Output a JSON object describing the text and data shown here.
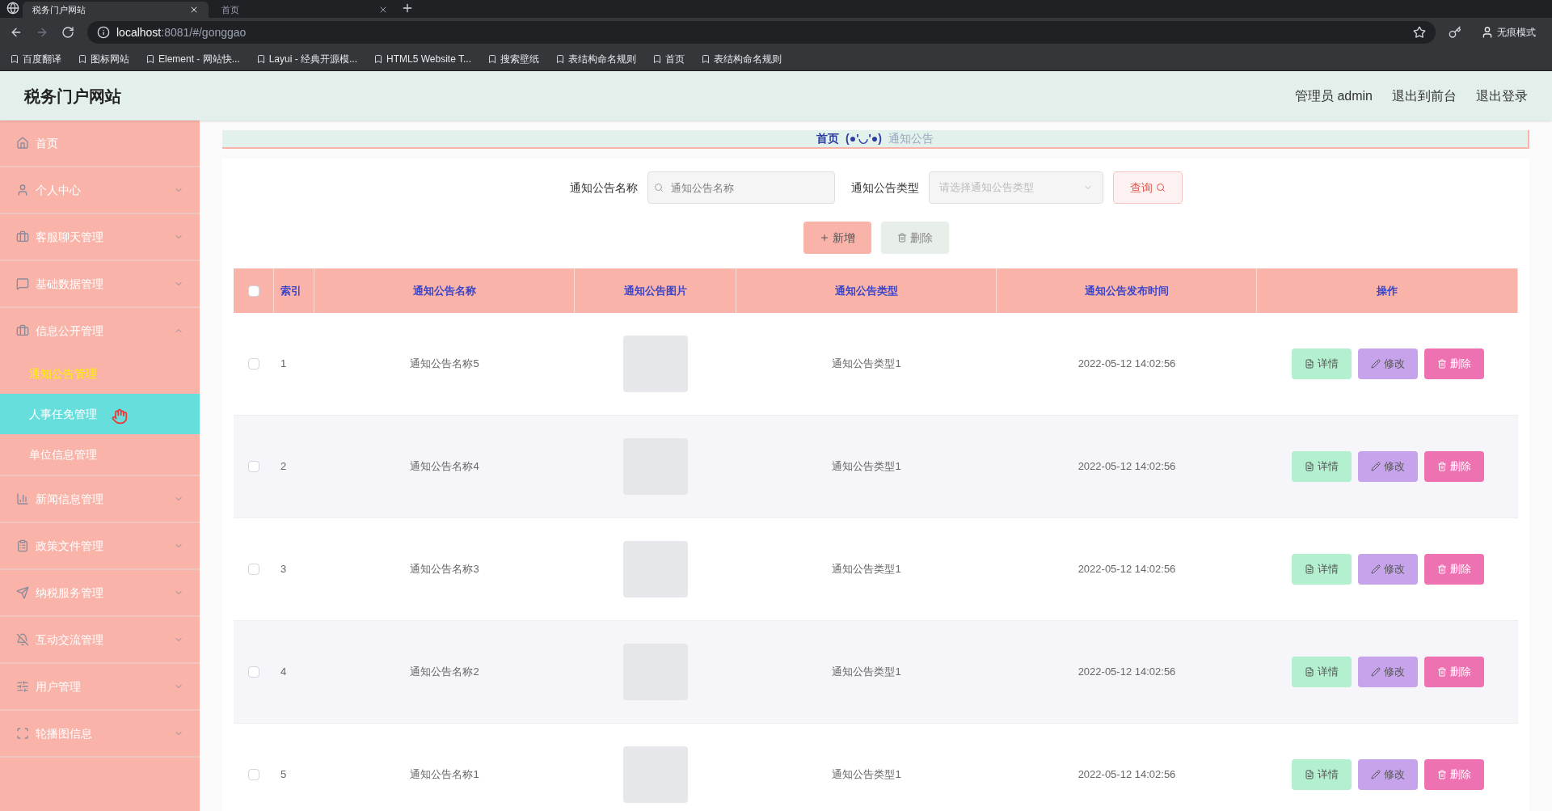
{
  "browser": {
    "tabs": [
      {
        "title": "税务门户网站",
        "selected": true
      },
      {
        "title": "首页",
        "selected": false
      }
    ],
    "url_host": "localhost",
    "url_rest": ":8081/#/gonggao",
    "profile": "无痕模式",
    "bookmarks": [
      "百度翻译",
      "图标网站",
      "Element - 网站快...",
      "Layui - 经典开源模...",
      "HTML5 Website T...",
      "搜索壁纸",
      "表结构命名规则",
      "首页",
      "表结构命名规则"
    ]
  },
  "header": {
    "title": "税务门户网站",
    "links": [
      "管理员 admin",
      "退出到前台",
      "退出登录"
    ]
  },
  "sidebar": {
    "items": [
      {
        "label": "首页",
        "kind": "link"
      },
      {
        "label": "个人中心",
        "kind": "group",
        "expanded": false
      },
      {
        "label": "客服聊天管理",
        "kind": "group",
        "expanded": false
      },
      {
        "label": "基础数据管理",
        "kind": "group",
        "expanded": false
      },
      {
        "label": "信息公开管理",
        "kind": "group",
        "expanded": true,
        "children": [
          {
            "label": "通知公告管理",
            "selected": true,
            "hovered": false
          },
          {
            "label": "人事任免管理",
            "selected": false,
            "hovered": true
          },
          {
            "label": "单位信息管理",
            "selected": false,
            "hovered": false
          }
        ]
      },
      {
        "label": "新闻信息管理",
        "kind": "group",
        "expanded": false
      },
      {
        "label": "政策文件管理",
        "kind": "group",
        "expanded": false
      },
      {
        "label": "纳税服务管理",
        "kind": "group",
        "expanded": false
      },
      {
        "label": "互动交流管理",
        "kind": "group",
        "expanded": false
      },
      {
        "label": "用户管理",
        "kind": "group",
        "expanded": false
      },
      {
        "label": "轮播图信息",
        "kind": "group",
        "expanded": false
      }
    ]
  },
  "breadcrumb": {
    "home": "首页",
    "separator": "(●'◡'●)",
    "current": "通知公告"
  },
  "search": {
    "name_label": "通知公告名称",
    "name_placeholder": "通知公告名称",
    "type_label": "通知公告类型",
    "type_placeholder": "请选择通知公告类型",
    "query_button": "查询"
  },
  "actions": {
    "add": "新增",
    "delete": "删除"
  },
  "table": {
    "select_all_checked": false,
    "columns": [
      "索引",
      "通知公告名称",
      "通知公告图片",
      "通知公告类型",
      "通知公告发布时间",
      "操作"
    ],
    "rows": [
      {
        "index": "1",
        "name": "通知公告名称5",
        "type": "通知公告类型1",
        "time": "2022-05-12 14:02:56",
        "checked": false,
        "buttons": [
          {
            "kind": "detail",
            "label": "详情"
          },
          {
            "kind": "edit",
            "label": "修改"
          },
          {
            "kind": "delete",
            "label": "删除"
          }
        ]
      },
      {
        "index": "2",
        "name": "通知公告名称4",
        "type": "通知公告类型1",
        "time": "2022-05-12 14:02:56",
        "checked": false,
        "buttons": [
          {
            "kind": "detail",
            "label": "详情"
          },
          {
            "kind": "edit",
            "label": "修改"
          },
          {
            "kind": "delete",
            "label": "删除"
          }
        ]
      },
      {
        "index": "3",
        "name": "通知公告名称3",
        "type": "通知公告类型1",
        "time": "2022-05-12 14:02:56",
        "checked": false,
        "buttons": [
          {
            "kind": "detail",
            "label": "详情"
          },
          {
            "kind": "edit",
            "label": "修改"
          },
          {
            "kind": "delete",
            "label": "删除"
          }
        ]
      },
      {
        "index": "4",
        "name": "通知公告名称2",
        "type": "通知公告类型1",
        "time": "2022-05-12 14:02:56",
        "checked": false,
        "buttons": [
          {
            "kind": "detail",
            "label": "详情"
          },
          {
            "kind": "edit",
            "label": "修改"
          },
          {
            "kind": "delete",
            "label": "删除"
          }
        ]
      },
      {
        "index": "5",
        "name": "通知公告名称1",
        "type": "通知公告类型1",
        "time": "2022-05-12 14:02:56",
        "checked": false,
        "buttons": [
          {
            "kind": "detail",
            "label": "详情"
          },
          {
            "kind": "edit",
            "label": "修改"
          },
          {
            "kind": "delete",
            "label": "删除"
          }
        ]
      }
    ]
  }
}
